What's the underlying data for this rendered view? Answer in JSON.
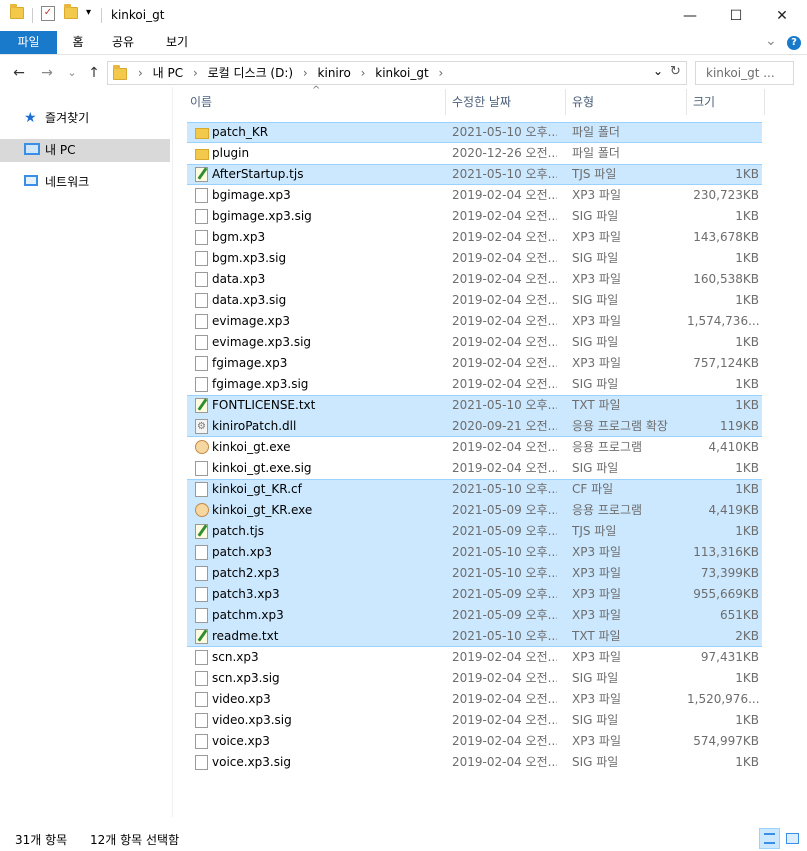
{
  "window": {
    "title": "kinkoi_gt",
    "minimize": "—",
    "maximize": "☐",
    "close": "✕"
  },
  "ribbon": {
    "tabs": [
      "파일",
      "홈",
      "공유",
      "보기"
    ],
    "expand": "⌄",
    "help": "?"
  },
  "address": {
    "back": "←",
    "forward": "→",
    "history": "⌄",
    "up": "↑",
    "crumbs": [
      "내 PC",
      "로컬 디스크 (D:)",
      "kiniro",
      "kinkoi_gt"
    ],
    "separator": "›",
    "dropdown": "⌄",
    "refresh": "↻",
    "search_placeholder": "kinkoi_gt ..."
  },
  "nav": {
    "items": [
      {
        "label": "즐겨찾기",
        "icon": "star-icon"
      },
      {
        "label": "내 PC",
        "icon": "computer-icon",
        "selected": true
      },
      {
        "label": "네트워크",
        "icon": "network-icon"
      }
    ]
  },
  "columns": {
    "sort_arrow": "^",
    "name": "이름",
    "date": "수정한 날짜",
    "type": "유형",
    "size": "크기"
  },
  "files": [
    {
      "name": "patch_KR",
      "date": "2021-05-10 오후...",
      "type": "파일 폴더",
      "size": "",
      "icon": "folder",
      "selected": true
    },
    {
      "name": "plugin",
      "date": "2020-12-26 오전...",
      "type": "파일 폴더",
      "size": "",
      "icon": "folder",
      "selected": false
    },
    {
      "name": "AfterStartup.tjs",
      "date": "2021-05-10 오후...",
      "type": "TJS 파일",
      "size": "1KB",
      "icon": "note",
      "selected": true
    },
    {
      "name": "bgimage.xp3",
      "date": "2019-02-04 오전...",
      "type": "XP3 파일",
      "size": "230,723KB",
      "icon": "doc",
      "selected": false
    },
    {
      "name": "bgimage.xp3.sig",
      "date": "2019-02-04 오전...",
      "type": "SIG 파일",
      "size": "1KB",
      "icon": "doc",
      "selected": false
    },
    {
      "name": "bgm.xp3",
      "date": "2019-02-04 오전...",
      "type": "XP3 파일",
      "size": "143,678KB",
      "icon": "doc",
      "selected": false
    },
    {
      "name": "bgm.xp3.sig",
      "date": "2019-02-04 오전...",
      "type": "SIG 파일",
      "size": "1KB",
      "icon": "doc",
      "selected": false
    },
    {
      "name": "data.xp3",
      "date": "2019-02-04 오전...",
      "type": "XP3 파일",
      "size": "160,538KB",
      "icon": "doc",
      "selected": false
    },
    {
      "name": "data.xp3.sig",
      "date": "2019-02-04 오전...",
      "type": "SIG 파일",
      "size": "1KB",
      "icon": "doc",
      "selected": false
    },
    {
      "name": "evimage.xp3",
      "date": "2019-02-04 오전...",
      "type": "XP3 파일",
      "size": "1,574,736...",
      "icon": "doc",
      "selected": false
    },
    {
      "name": "evimage.xp3.sig",
      "date": "2019-02-04 오전...",
      "type": "SIG 파일",
      "size": "1KB",
      "icon": "doc",
      "selected": false
    },
    {
      "name": "fgimage.xp3",
      "date": "2019-02-04 오전...",
      "type": "XP3 파일",
      "size": "757,124KB",
      "icon": "doc",
      "selected": false
    },
    {
      "name": "fgimage.xp3.sig",
      "date": "2019-02-04 오전...",
      "type": "SIG 파일",
      "size": "1KB",
      "icon": "doc",
      "selected": false
    },
    {
      "name": "FONTLICENSE.txt",
      "date": "2021-05-10 오후...",
      "type": "TXT 파일",
      "size": "1KB",
      "icon": "note",
      "selected": true
    },
    {
      "name": "kiniroPatch.dll",
      "date": "2020-09-21 오전...",
      "type": "응용 프로그램 확장",
      "size": "119KB",
      "icon": "gear",
      "selected": true
    },
    {
      "name": "kinkoi_gt.exe",
      "date": "2019-02-04 오전...",
      "type": "응용 프로그램",
      "size": "4,410KB",
      "icon": "exe",
      "selected": false
    },
    {
      "name": "kinkoi_gt.exe.sig",
      "date": "2019-02-04 오전...",
      "type": "SIG 파일",
      "size": "1KB",
      "icon": "doc",
      "selected": false
    },
    {
      "name": "kinkoi_gt_KR.cf",
      "date": "2021-05-10 오후...",
      "type": "CF 파일",
      "size": "1KB",
      "icon": "doc",
      "selected": true
    },
    {
      "name": "kinkoi_gt_KR.exe",
      "date": "2021-05-09 오후...",
      "type": "응용 프로그램",
      "size": "4,419KB",
      "icon": "exe",
      "selected": true
    },
    {
      "name": "patch.tjs",
      "date": "2021-05-09 오후...",
      "type": "TJS 파일",
      "size": "1KB",
      "icon": "note",
      "selected": true
    },
    {
      "name": "patch.xp3",
      "date": "2021-05-10 오후...",
      "type": "XP3 파일",
      "size": "113,316KB",
      "icon": "doc",
      "selected": true
    },
    {
      "name": "patch2.xp3",
      "date": "2021-05-10 오후...",
      "type": "XP3 파일",
      "size": "73,399KB",
      "icon": "doc",
      "selected": true
    },
    {
      "name": "patch3.xp3",
      "date": "2021-05-09 오후...",
      "type": "XP3 파일",
      "size": "955,669KB",
      "icon": "doc",
      "selected": true
    },
    {
      "name": "patchm.xp3",
      "date": "2021-05-09 오후...",
      "type": "XP3 파일",
      "size": "651KB",
      "icon": "doc",
      "selected": true
    },
    {
      "name": "readme.txt",
      "date": "2021-05-10 오후...",
      "type": "TXT 파일",
      "size": "2KB",
      "icon": "note",
      "selected": true
    },
    {
      "name": "scn.xp3",
      "date": "2019-02-04 오전...",
      "type": "XP3 파일",
      "size": "97,431KB",
      "icon": "doc",
      "selected": false
    },
    {
      "name": "scn.xp3.sig",
      "date": "2019-02-04 오전...",
      "type": "SIG 파일",
      "size": "1KB",
      "icon": "doc",
      "selected": false
    },
    {
      "name": "video.xp3",
      "date": "2019-02-04 오전...",
      "type": "XP3 파일",
      "size": "1,520,976...",
      "icon": "doc",
      "selected": false
    },
    {
      "name": "video.xp3.sig",
      "date": "2019-02-04 오전...",
      "type": "SIG 파일",
      "size": "1KB",
      "icon": "doc",
      "selected": false
    },
    {
      "name": "voice.xp3",
      "date": "2019-02-04 오전...",
      "type": "XP3 파일",
      "size": "574,997KB",
      "icon": "doc",
      "selected": false
    },
    {
      "name": "voice.xp3.sig",
      "date": "2019-02-04 오전...",
      "type": "SIG 파일",
      "size": "1KB",
      "icon": "doc",
      "selected": false
    }
  ],
  "status": {
    "count": "31개 항목",
    "selected": "12개 항목 선택함"
  },
  "colors": {
    "accent": "#1979ca",
    "selection": "#cce8ff",
    "selection_border": "#99d1ff"
  }
}
